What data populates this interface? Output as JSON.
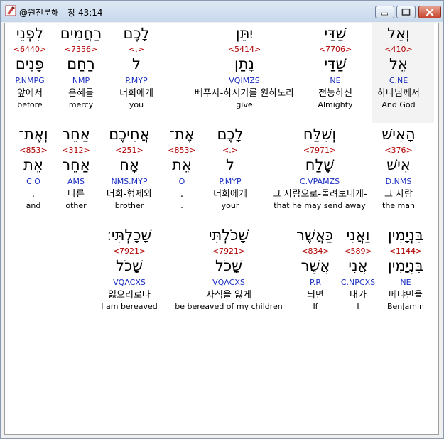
{
  "window": {
    "title": "@원전분해 - 창 43:14",
    "icon": "app-icon"
  },
  "rows": [
    {
      "words": [
        {
          "heb": "לִפְנֵי",
          "strong": "<6440>",
          "lemma": "פָּנִים",
          "parse": "P.NMPG",
          "kor": "앞에서",
          "eng": "before"
        },
        {
          "heb": "רַחֲמִים",
          "strong": "<7356>",
          "lemma": "רַחַם",
          "parse": "NMP",
          "kor": "은혜를",
          "eng": "mercy"
        },
        {
          "heb": "לָכֶם",
          "strong": "<.>",
          "lemma": "ל",
          "parse": "P.MYP",
          "kor": "너희에게",
          "eng": "you"
        },
        {
          "heb": "יִתֵּן",
          "strong": "<5414>",
          "lemma": "נָתַן",
          "parse": "VQIMZS",
          "kor": "베푸사-하시기를 원하노라",
          "eng": "give"
        },
        {
          "heb": "שַׁדַּי",
          "strong": "<7706>",
          "lemma": "שַׁדַּי",
          "parse": "NE",
          "kor": "전능하신",
          "eng": "Almighty"
        },
        {
          "heb": "וְאֵל",
          "strong": "<410>",
          "lemma": "אֵל",
          "parse": "C.NE",
          "kor": "하나님께서",
          "eng": "And God"
        }
      ]
    },
    {
      "words": [
        {
          "heb": "וְאֶת־",
          "strong": "<853>",
          "lemma": "אֵת",
          "parse": "C.O",
          "kor": ".",
          "eng": "and"
        },
        {
          "heb": "אַחֵר",
          "strong": "<312>",
          "lemma": "אַחֵר",
          "parse": "AMS",
          "kor": "다른",
          "eng": "other"
        },
        {
          "heb": "אֲחִיכֶם",
          "strong": "<251>",
          "lemma": "אָח",
          "parse": "NMS.MYP",
          "kor": "너희-형제와",
          "eng": "brother"
        },
        {
          "heb": "אֶת־",
          "strong": "<853>",
          "lemma": "אֵת",
          "parse": "O",
          "kor": ".",
          "eng": "."
        },
        {
          "heb": "לָכֶם",
          "strong": "<.>",
          "lemma": "ל",
          "parse": "P.MYP",
          "kor": "너희에게",
          "eng": "your"
        },
        {
          "heb": "וְשִׁלַּח",
          "strong": "<7971>",
          "lemma": "שָׁלַח",
          "parse": "C.VPAMZS",
          "kor": "그 사람으로-돌려보내게-",
          "eng": "that he may send away"
        },
        {
          "heb": "הָאִישׁ",
          "strong": "<376>",
          "lemma": "אִישׁ",
          "parse": "D.NMS",
          "kor": "그 사람",
          "eng": "the man"
        }
      ]
    },
    {
      "words": [
        {
          "heb": "שָׁכָלְתִּי׃",
          "strong": "<7921>",
          "lemma": "שָׁכֹל",
          "parse": "VQACXS",
          "kor": "잃으리로다",
          "eng": "I am bereaved"
        },
        {
          "heb": "שָׁכֹלְתִּי",
          "strong": "<7921>",
          "lemma": "שָׁכֹל",
          "parse": "VQACXS",
          "kor": "자식을 잃게",
          "eng": "be bereaved of my children"
        },
        {
          "heb": "כַּאֲשֶׁר",
          "strong": "<834>",
          "lemma": "אֲשֶׁר",
          "parse": "P.R",
          "kor": "되면",
          "eng": "If"
        },
        {
          "heb": "וַאֲנִי",
          "strong": "<589>",
          "lemma": "אֲנִי",
          "parse": "C.NPCXS",
          "kor": "내가",
          "eng": "I"
        },
        {
          "heb": "בִּנְיָמִין",
          "strong": "<1144>",
          "lemma": "בִּנְיָמִין",
          "parse": "NE",
          "kor": "베냐민을",
          "eng": "BenJamin"
        }
      ]
    }
  ]
}
